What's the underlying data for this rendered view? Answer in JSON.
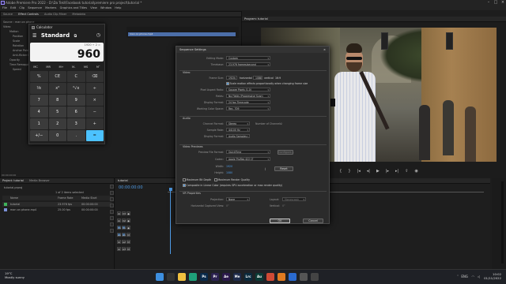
{
  "app": {
    "title": "Adobe Premiere Pro 2022 - D:\\Da Tekl\\Facebook tutorial\\premiere pro project\\tutorial *"
  },
  "menu": [
    "File",
    "Edit",
    "Clip",
    "Sequence",
    "Markers",
    "Graphics and Titles",
    "View",
    "Window",
    "Help"
  ],
  "top_tabs": [
    "Source",
    "Effect Controls",
    "Audio Clip Mixer",
    "Metadata"
  ],
  "effects_list": [
    "Source : man on phone",
    "Video",
    "Motion",
    "Position",
    "Scale",
    "Rotation",
    "Anchor Point",
    "Anti-flicker Filter",
    "Opacity",
    "Time Remapping",
    "Speed"
  ],
  "program_tab": "Program: tutorial",
  "clip_label": "man on phone.mp4",
  "calculator": {
    "title": "Calculator",
    "mode": "Standard",
    "display": "960",
    "expression": "1920 ÷ 2 =",
    "memory": [
      "MC",
      "MR",
      "M+",
      "M-",
      "MS",
      "M˅"
    ],
    "keys": [
      {
        "label": "%",
        "kind": "fn"
      },
      {
        "label": "CE",
        "kind": "fn"
      },
      {
        "label": "C",
        "kind": "fn"
      },
      {
        "label": "⌫",
        "kind": "fn"
      },
      {
        "label": "⅟x",
        "kind": "fn"
      },
      {
        "label": "x²",
        "kind": "fn"
      },
      {
        "label": "²√x",
        "kind": "fn"
      },
      {
        "label": "÷",
        "kind": "fn"
      },
      {
        "label": "7",
        "kind": "num"
      },
      {
        "label": "8",
        "kind": "num"
      },
      {
        "label": "9",
        "kind": "num"
      },
      {
        "label": "×",
        "kind": "fn"
      },
      {
        "label": "4",
        "kind": "num"
      },
      {
        "label": "5",
        "kind": "num"
      },
      {
        "label": "6",
        "kind": "num"
      },
      {
        "label": "−",
        "kind": "fn"
      },
      {
        "label": "1",
        "kind": "num"
      },
      {
        "label": "2",
        "kind": "num"
      },
      {
        "label": "3",
        "kind": "num"
      },
      {
        "label": "+",
        "kind": "fn"
      },
      {
        "label": "+/−",
        "kind": "num"
      },
      {
        "label": "0",
        "kind": "num"
      },
      {
        "label": ".",
        "kind": "num"
      },
      {
        "label": "=",
        "kind": "eq"
      }
    ]
  },
  "dialog": {
    "title": "Sequence Settings",
    "editing_mode_label": "Editing Mode:",
    "editing_mode": "Custom",
    "timebase_label": "Timebase:",
    "timebase": "23.976 frames/second",
    "video_section": "Video",
    "frame_size_label": "Frame Size:",
    "frame_w": "1920",
    "horizontal": "horizontal",
    "frame_h": "1080",
    "vertical": "vertical",
    "ratio": "16:9",
    "scale_note": "Scale motion effects proportionally when changing frame size",
    "pixel_aspect_label": "Pixel Aspect Ratio:",
    "pixel_aspect": "Square Pixels (1.0)",
    "fields_label": "Fields:",
    "fields": "No Fields (Progressive Scan)",
    "display_format_label": "Display Format:",
    "display_format": "24 fps Timecode",
    "color_space_label": "Working Color Space:",
    "color_space": "Rec. 709",
    "audio_section": "Audio",
    "channel_format_label": "Channel Format:",
    "channel_format": "Stereo",
    "channels_label": "Number of Channels:",
    "channels": "2",
    "sample_rate_label": "Sample Rate:",
    "sample_rate": "44100 Hz",
    "audio_display_label": "Display Format:",
    "audio_display": "Audio Samples",
    "previews_section": "Video Previews",
    "preview_format_label": "Preview File Format:",
    "preview_format": "QuickTime",
    "configure": "Configure...",
    "codec_label": "Codec:",
    "codec": "Apple ProRes 422 LT",
    "width_label": "Width:",
    "width": "1920",
    "height_label": "Height:",
    "height": "1080",
    "reset": "Reset",
    "max_bit_depth": "Maximum Bit Depth",
    "max_render": "Maximum Render Quality",
    "composite_linear": "Composite in Linear Color (requires GPU acceleration or max render quality)",
    "vr_section": "VR Properties",
    "projection_label": "Projection:",
    "projection": "None",
    "layout_label": "Layout:",
    "layout": "Monoscopic",
    "h_view_label": "Horizontal Captured View:",
    "h_view": "0°",
    "vertical_label": "Vertical:",
    "vertical_val": "0°",
    "ok": "OK",
    "cancel": "Cancel"
  },
  "project_panel": {
    "tabs": [
      "Project: tutorial",
      "Media Browser"
    ],
    "project_file": "tutorial.prproj",
    "item_count": "1 of 2 items selected",
    "col_name": "Name",
    "col_fps": "Frame Rate",
    "col_start": "Media Start",
    "items": [
      {
        "name": "tutorial",
        "fps": "23.976 fps",
        "start": "00:00:00:00",
        "color": "#3fb35a"
      },
      {
        "name": "man on phone.mp4",
        "fps": "25.00 fps",
        "start": "00:00:00:00",
        "color": "#7a8fd6"
      }
    ]
  },
  "timeline": {
    "tab": "tutorial",
    "timecode": "00:00:00:00",
    "tracks": [
      "V3",
      "V2",
      "V1",
      "A1",
      "A2",
      "A3"
    ]
  },
  "taskbar": {
    "temp": "19°C",
    "weather": "Mostly sunny",
    "lang": "ENG",
    "time": "10:02",
    "date": "01/11/2022",
    "apps": [
      {
        "name": "start",
        "label": "",
        "color": "#3d8fe0"
      },
      {
        "name": "search",
        "label": "",
        "color": "#333"
      },
      {
        "name": "explorer",
        "label": "",
        "color": "#f0c040"
      },
      {
        "name": "edge",
        "label": "",
        "color": "#1fa07a"
      },
      {
        "name": "photoshop",
        "label": "Ps",
        "color": "#0a2a4a"
      },
      {
        "name": "premiere",
        "label": "Pr",
        "color": "#2b2250"
      },
      {
        "name": "after-effects",
        "label": "Ae",
        "color": "#2b1a4a"
      },
      {
        "name": "media-encoder",
        "label": "Me",
        "color": "#1e2b4a"
      },
      {
        "name": "lightroom",
        "label": "Lrc",
        "color": "#0b2a3d"
      },
      {
        "name": "audition",
        "label": "Au",
        "color": "#0b3a35"
      },
      {
        "name": "chrome",
        "label": "",
        "color": "#d04a35"
      },
      {
        "name": "firefox",
        "label": "",
        "color": "#e07a20"
      },
      {
        "name": "mail",
        "label": "",
        "color": "#2a6ad0"
      },
      {
        "name": "store",
        "label": "",
        "color": "#555"
      },
      {
        "name": "calculator",
        "label": "",
        "color": "#444"
      }
    ]
  }
}
